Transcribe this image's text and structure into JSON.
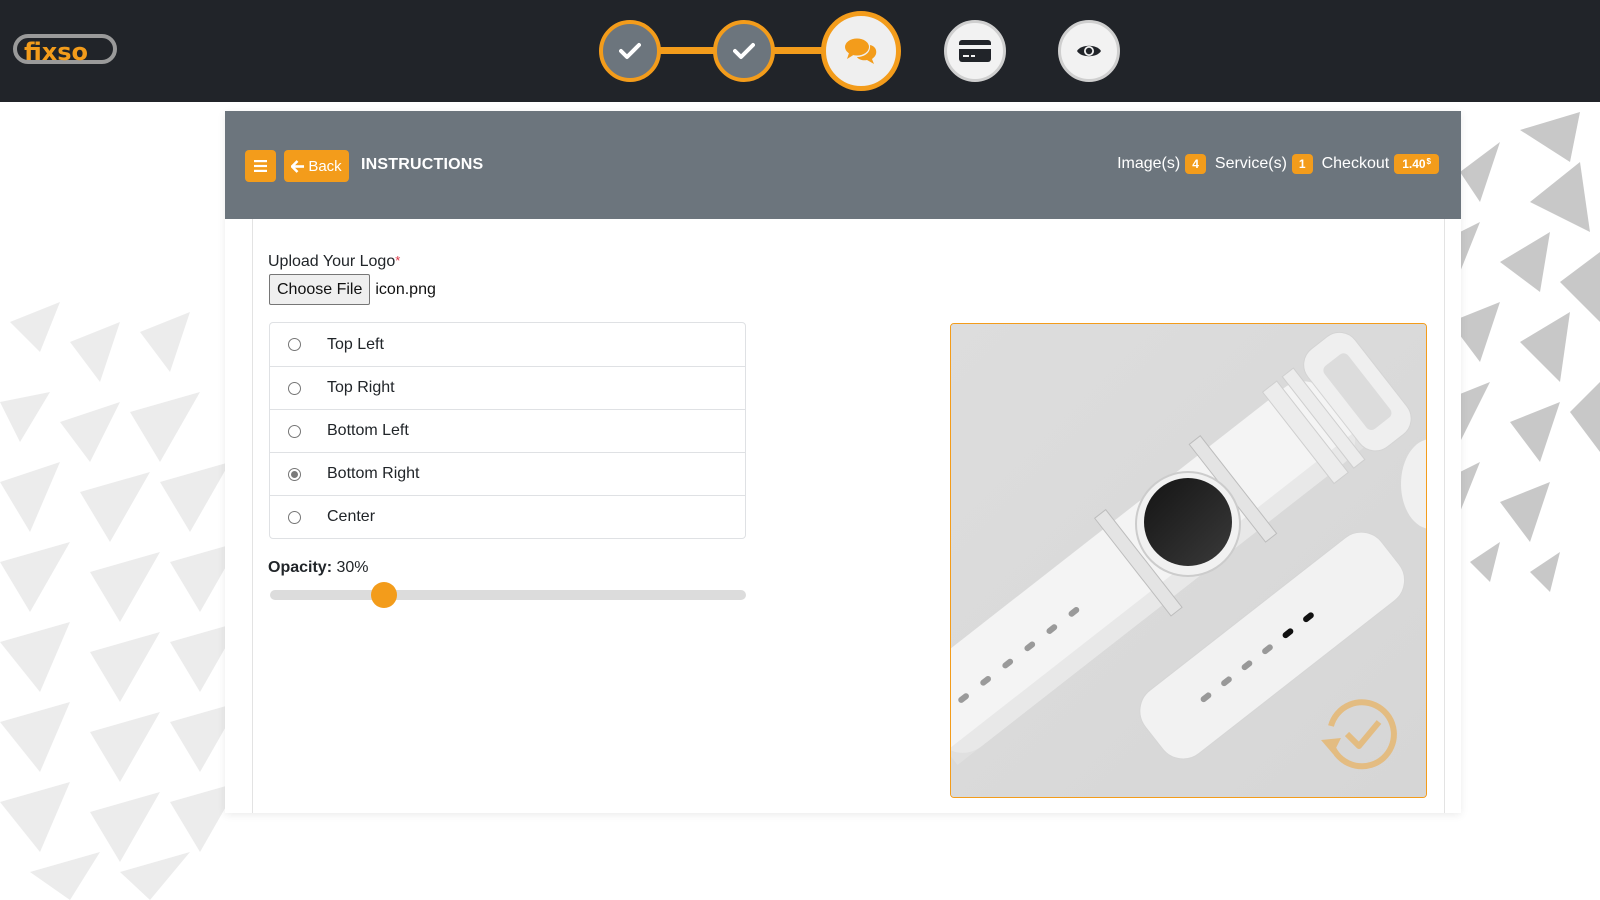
{
  "brand": {
    "logo_text": "fixso",
    "accent_color": "#f39c1b",
    "dark_color": "#212429",
    "header_color": "#6c757d"
  },
  "stepper": {
    "steps": [
      {
        "icon": "check-icon",
        "state": "done"
      },
      {
        "icon": "check-icon",
        "state": "done"
      },
      {
        "icon": "comments-icon",
        "state": "active"
      },
      {
        "icon": "credit-card-icon",
        "state": "todo"
      },
      {
        "icon": "eye-icon",
        "state": "todo"
      }
    ]
  },
  "header": {
    "menu_icon": "bars-icon",
    "back_label": "Back",
    "title": "INSTRUCTIONS",
    "stats": {
      "images_label": "Image(s)",
      "images_count": "4",
      "services_label": "Service(s)",
      "services_count": "1",
      "checkout_label": "Checkout",
      "checkout_amount": "1.40",
      "currency": "$"
    }
  },
  "form": {
    "upload_label": "Upload Your Logo",
    "required_mark": "*",
    "choose_file_label": "Choose File",
    "file_name": "icon.png",
    "positions": [
      {
        "label": "Top Left",
        "checked": false
      },
      {
        "label": "Top Right",
        "checked": false
      },
      {
        "label": "Bottom Left",
        "checked": false
      },
      {
        "label": "Bottom Right",
        "checked": true
      },
      {
        "label": "Center",
        "checked": false
      }
    ],
    "opacity_label": "Opacity:",
    "opacity_value_text": "30%",
    "opacity_fraction": 0.24
  },
  "preview": {
    "subject": "white smartwatch product photo",
    "watermark_icon": "sync-check-icon",
    "watermark_position": "bottom-right",
    "watermark_opacity": 0.3
  }
}
